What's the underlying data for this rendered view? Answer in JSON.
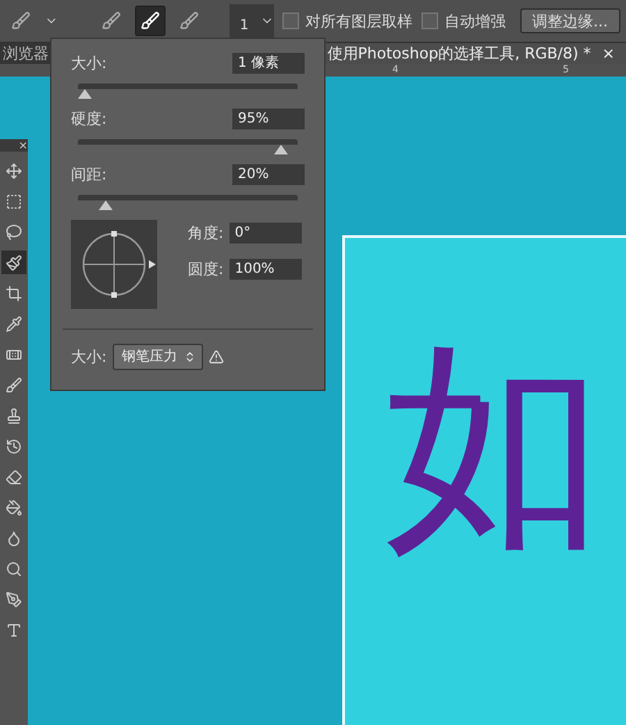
{
  "options_bar": {
    "brush_size": "1",
    "sample_all_layers": {
      "label": "对所有图层取样",
      "checked": false
    },
    "auto_enhance": {
      "label": "自动增强",
      "checked": false
    },
    "refine_button": "调整边缘...",
    "modes": [
      {
        "selected": false
      },
      {
        "selected": true
      },
      {
        "selected": false
      }
    ]
  },
  "tabs": [
    {
      "label": "浏览器",
      "selected": false
    },
    {
      "label": "使用Photoshop的选择工具, RGB/8) *",
      "close": "×",
      "selected": true
    }
  ],
  "ruler": [
    "4",
    "5"
  ],
  "brush_popup": {
    "size": {
      "label": "大小:",
      "value": "1 像素",
      "level": 0.0
    },
    "hardness": {
      "label": "硬度:",
      "value": "95%",
      "level": 0.95
    },
    "spacing": {
      "label": "间距:",
      "value": "20%",
      "level": 0.1
    },
    "angle": {
      "label": "角度:",
      "value": "0°"
    },
    "roundness": {
      "label": "圆度:",
      "value": "100%"
    },
    "pressure": {
      "label": "大小:",
      "value": "钢笔压力"
    }
  },
  "toolbox": {
    "close": "×",
    "tools": [
      {
        "selected": false
      },
      {
        "selected": false
      },
      {
        "selected": false
      },
      {
        "selected": true
      },
      {
        "selected": false
      },
      {
        "selected": false
      },
      {
        "selected": false
      },
      {
        "selected": false
      },
      {
        "selected": false
      },
      {
        "selected": false
      },
      {
        "selected": false
      },
      {
        "selected": false
      },
      {
        "selected": false
      },
      {
        "selected": false
      },
      {
        "selected": false
      },
      {
        "selected": false
      }
    ]
  },
  "canvas": {
    "text": "如"
  }
}
